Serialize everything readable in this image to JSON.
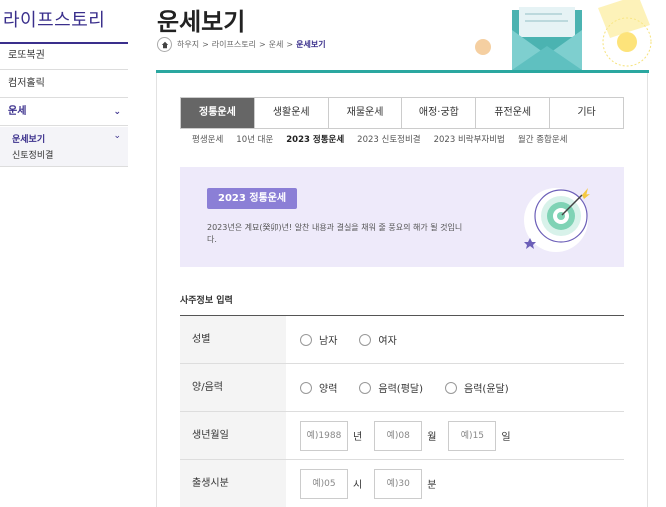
{
  "sidebar": {
    "title": "라이프스토리",
    "items": [
      {
        "label": "로또복권"
      },
      {
        "label": "컴저홀릭"
      },
      {
        "label": "운세"
      }
    ],
    "sub_items": [
      {
        "label": "운세보기"
      },
      {
        "label": "신토정비결"
      }
    ]
  },
  "header": {
    "title": "운세보기",
    "breadcrumb": [
      "하우지",
      "라이프스토리",
      "운세"
    ],
    "breadcrumb_sep": ">",
    "breadcrumb_current": "운세보기"
  },
  "tabs": [
    "정통운세",
    "생활운세",
    "재물운세",
    "애정·궁합",
    "퓨전운세",
    "기타"
  ],
  "subtabs": [
    "평생운세",
    "10년 대운",
    "2023 정통운세",
    "2023 신토정비결",
    "2023 비락부자비법",
    "월간 종합운세"
  ],
  "banner": {
    "badge": "2023 정통운세",
    "text": "2023년은 계묘(癸卯)년! 알찬 내용과 결실을 채워 줄 풍요의 해가 될 것입니다."
  },
  "form": {
    "heading": "사주정보 입력",
    "gender_label": "성별",
    "gender_options": [
      "남자",
      "여자"
    ],
    "calendar_label": "양/음력",
    "calendar_options": [
      "양력",
      "음력(평달)",
      "음력(윤달)"
    ],
    "birth_label": "생년월일",
    "birth_placeholders": [
      "예)1988",
      "예)08",
      "예)15"
    ],
    "birth_units": [
      "년",
      "월",
      "일"
    ],
    "time_label": "출생시분",
    "time_placeholders": [
      "예)05",
      "예)30"
    ],
    "time_units": [
      "시",
      "분"
    ]
  },
  "colors": {
    "accent": "#3a2f8c",
    "teal": "#2aa7a0",
    "badge": "#8b7fd6",
    "banner_bg": "#eeeafa",
    "tab_active": "#666666"
  }
}
